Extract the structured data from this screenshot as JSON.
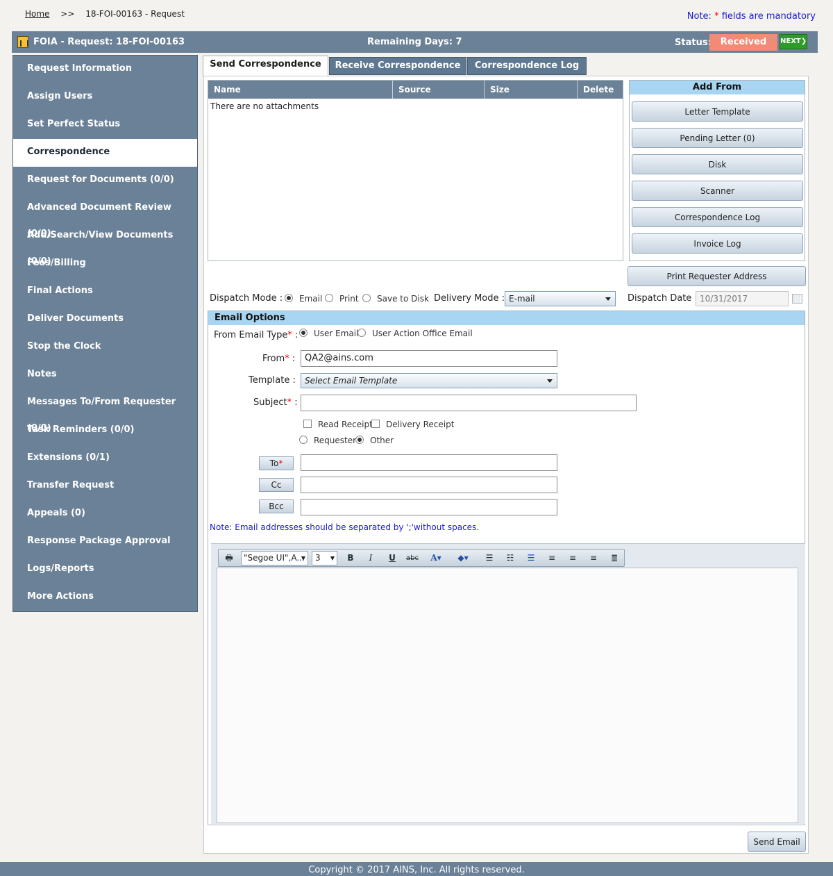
{
  "breadcrumb": {
    "home": "Home",
    "separator": ">>",
    "current": "18-FOI-00163 - Request"
  },
  "note_top": {
    "prefix": "Note:",
    "star": "*",
    "suffix": "fields are mandatory"
  },
  "titlebar": {
    "title": "FOIA - Request: 18-FOI-00163",
    "remaining_label": "Remaining Days:",
    "remaining_value": "7",
    "status_label": "Status:",
    "status_value": "Received",
    "next_label": "NEXT",
    "status_color": "#f28a76"
  },
  "sidebar": {
    "items": [
      {
        "label": "Request Information"
      },
      {
        "label": "Assign Users"
      },
      {
        "label": "Set Perfect Status"
      },
      {
        "label": "Correspondence",
        "active": true
      },
      {
        "label": "Request for Documents (0/0)"
      },
      {
        "label": "Advanced Document Review (0/0)"
      },
      {
        "label": "Add/Search/View Documents (0/0)"
      },
      {
        "label": "Fees/Billing"
      },
      {
        "label": "Final Actions"
      },
      {
        "label": "Deliver Documents"
      },
      {
        "label": "Stop the Clock"
      },
      {
        "label": "Notes"
      },
      {
        "label": "Messages To/From Requester (0/0)"
      },
      {
        "label": "Task Reminders (0/0)"
      },
      {
        "label": "Extensions (0/1)"
      },
      {
        "label": "Transfer Request"
      },
      {
        "label": "Appeals (0)"
      },
      {
        "label": "Response Package Approval"
      },
      {
        "label": "Logs/Reports"
      },
      {
        "label": "More Actions"
      }
    ]
  },
  "tabs": [
    {
      "label": "Send Correspondence",
      "active": true
    },
    {
      "label": "Receive Correspondence"
    },
    {
      "label": "Correspondence Log"
    }
  ],
  "attachments": {
    "columns": [
      "Name",
      "Source",
      "Size",
      "Delete"
    ],
    "empty_text": "There are no attachments"
  },
  "add_from": {
    "title": "Add From",
    "buttons": [
      "Letter Template",
      "Pending Letter (0)",
      "Disk",
      "Scanner",
      "Correspondence Log",
      "Invoice Log"
    ]
  },
  "print_requester_address": "Print Requester Address",
  "dispatch": {
    "mode_label": "Dispatch Mode :",
    "modes": [
      "Email",
      "Print",
      "Save to Disk"
    ],
    "selected_mode": "Email",
    "delivery_label": "Delivery Mode :",
    "delivery_value": "E-mail",
    "date_label": "Dispatch Date :",
    "date_value": "10/31/2017"
  },
  "email_options": {
    "title": "Email Options",
    "from_type_label": "From Email Type",
    "from_types": [
      "User Email",
      "User Action Office Email"
    ],
    "from_label": "From",
    "from_value": "QA2@ains.com",
    "template_label": "Template :",
    "template_placeholder": "Select Email Template",
    "subject_label": "Subject",
    "subject_value": "",
    "read_receipt": "Read Receipt",
    "delivery_receipt": "Delivery Receipt",
    "recipient_types": [
      "Requester",
      "Other"
    ],
    "to_label": "To",
    "cc_label": "Cc",
    "bcc_label": "Bcc",
    "note": "Note: Email addresses should be separated by ';'without spaces."
  },
  "editor": {
    "font_value": "\"Segoe UI\",A...",
    "size_value": "3"
  },
  "send_email": "Send Email",
  "footer": "Copyright © 2017 AINS, Inc. All rights reserved."
}
